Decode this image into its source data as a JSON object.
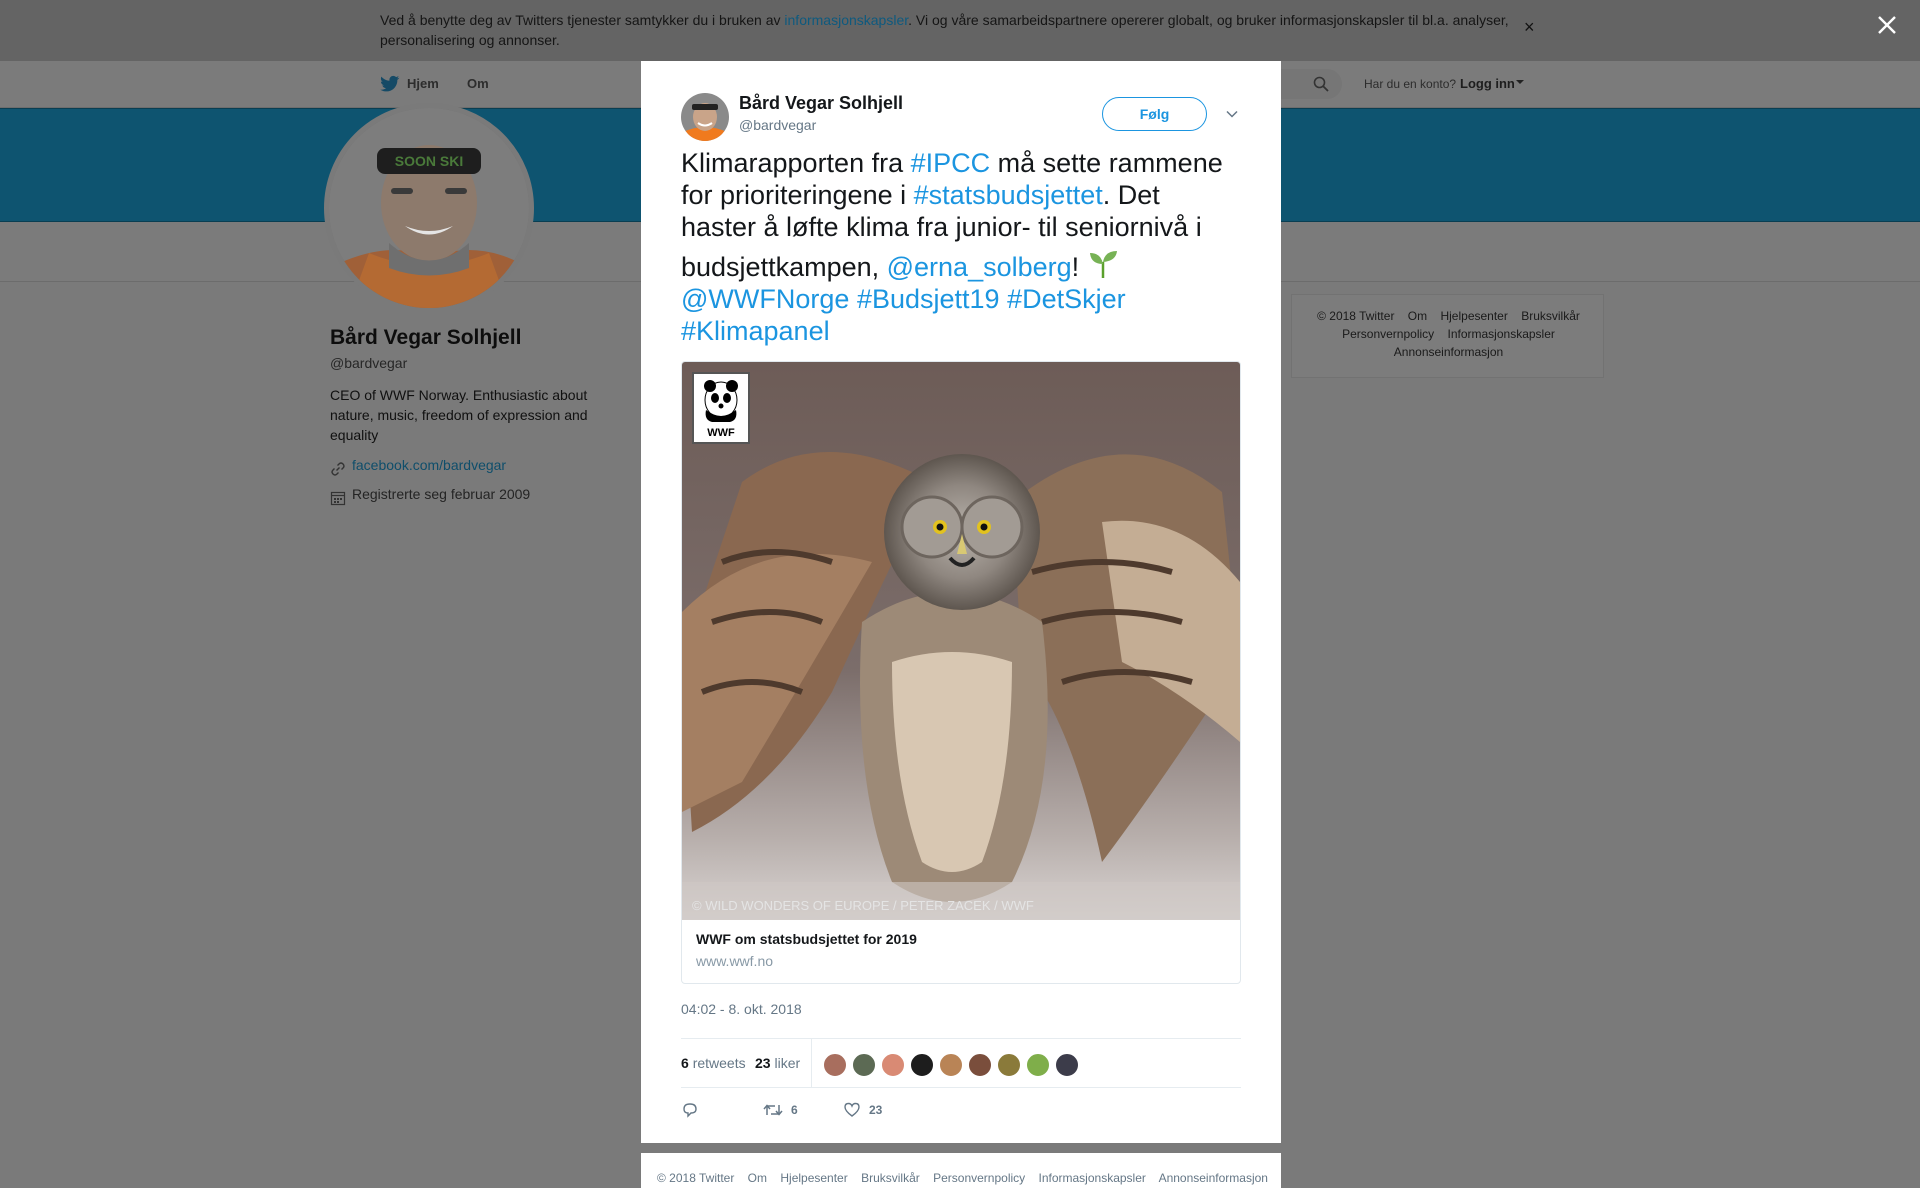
{
  "cookie": {
    "text_before": "Ved å benytte deg av Twitters tjenester samtykker du i bruken av ",
    "link": "informasjonskapsler",
    "text_after": ". Vi og våre samarbeidspartnere opererer globalt, og bruker informasjonskapsler til bl.a. analyser, personalisering og annonser.",
    "close": "×"
  },
  "nav": {
    "home": "Hjem",
    "about": "Om",
    "account_question": "Har du en konto?",
    "login": "Logg inn"
  },
  "profile": {
    "name": "Bård Vegar Solhjell",
    "handle": "@bardvegar",
    "bio": "CEO of WWF Norway. Enthusiastic about nature, music, freedom of expression and equality",
    "url": "facebook.com/bardvegar",
    "joined": "Registrerte seg februar 2009",
    "avatar_headband_text": "SOON SKI"
  },
  "side_footer": {
    "links": [
      "© 2018 Twitter",
      "Om",
      "Hjelpesenter",
      "Bruksvilkår",
      "Personvernpolicy",
      "Informasjonskapsler",
      "Annonseinformasjon"
    ]
  },
  "tweet": {
    "author_name": "Bård Vegar Solhjell",
    "author_handle": "@bardvegar",
    "follow_label": "Følg",
    "text": {
      "t1": "Klimarapporten fra ",
      "h1": "#IPCC",
      "t2": " må sette rammene",
      "t3": "for prioriteringene i ",
      "h2": "#statsbudsjettet",
      "t4": ". Det",
      "t5": "haster å løfte klima fra junior- til seniornivå i",
      "t6": "budsjettkampen, ",
      "h3": "@erna_solberg",
      "t7": "! ",
      "h4": "@WWFNorge",
      "h5": "#Budsjett19",
      "h6": "#DetSkjer",
      "h7": "#Klimapanel"
    },
    "card": {
      "logo_text": "WWF",
      "photo_credit": "© WILD WONDERS OF EUROPE / PETER ZACEK / WWF",
      "title": "WWF om statsbudsjettet for 2019",
      "domain": "www.wwf.no"
    },
    "timestamp": "04:02 - 8. okt. 2018",
    "retweets": "6",
    "retweets_label": "retweets",
    "likes": "23",
    "likes_label": "liker",
    "action_retweets": "6",
    "action_likes": "23"
  },
  "modal_footer": {
    "links": [
      "© 2018 Twitter",
      "Om",
      "Hjelpesenter",
      "Bruksvilkår",
      "Personvernpolicy",
      "Informasjonskapsler",
      "Annonseinformasjon"
    ]
  },
  "colors": {
    "link_blue": "#1b95e0",
    "banner": "#0e5470",
    "overlay": "#7a7a7a"
  },
  "icons": [
    "twitter-bird-icon",
    "search-icon",
    "link-icon",
    "calendar-icon",
    "chevron-down-icon",
    "seedling-icon",
    "reply-icon",
    "retweet-icon",
    "heart-icon",
    "close-icon"
  ]
}
